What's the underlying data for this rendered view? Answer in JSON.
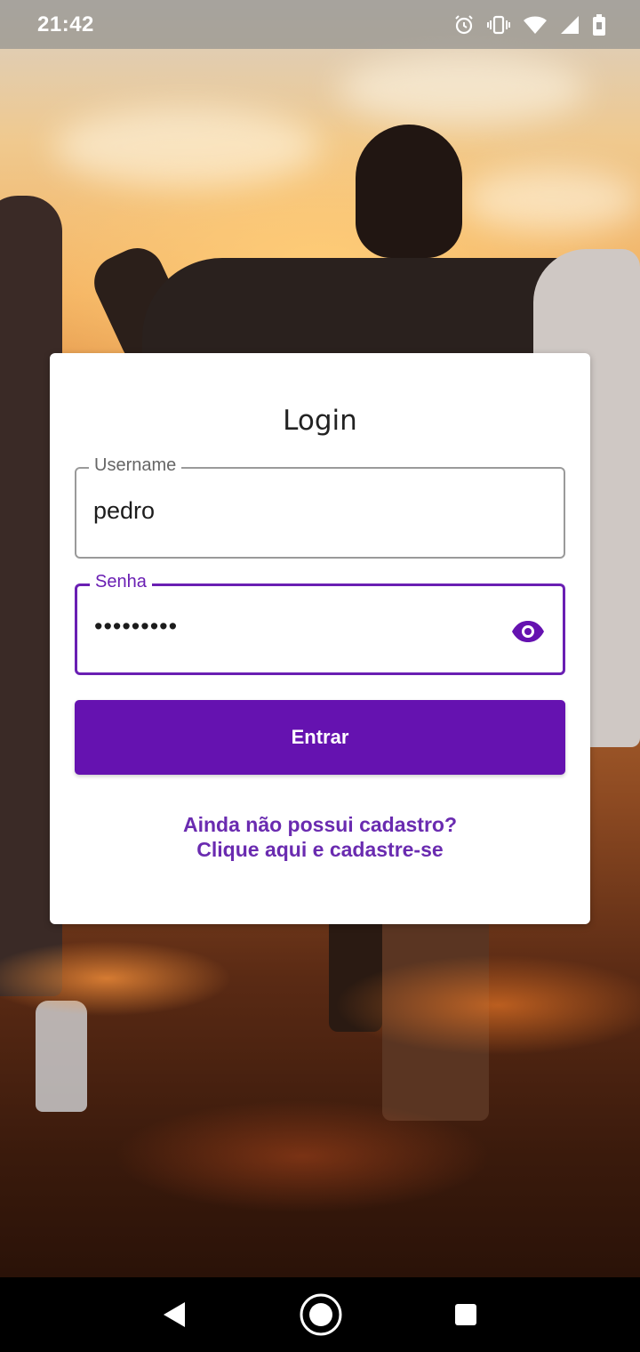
{
  "status_bar": {
    "time": "21:42",
    "icons": [
      "alarm-icon",
      "vibrate-icon",
      "wifi-icon",
      "cell-signal-icon",
      "battery-icon"
    ]
  },
  "login": {
    "title": "Login",
    "username": {
      "label": "Username",
      "value": "pedro"
    },
    "password": {
      "label": "Senha",
      "value": "•••••••••",
      "toggle_icon": "eye-icon"
    },
    "submit_label": "Entrar",
    "signup_line1": "Ainda não possui cadastro?",
    "signup_line2": "Clique aqui e cadastre-se"
  },
  "nav_bar": {
    "buttons": [
      "back-icon",
      "home-icon",
      "recents-icon"
    ]
  },
  "colors": {
    "accent": "#6512b0",
    "link": "#6a2bb0",
    "card_bg": "#ffffff"
  }
}
